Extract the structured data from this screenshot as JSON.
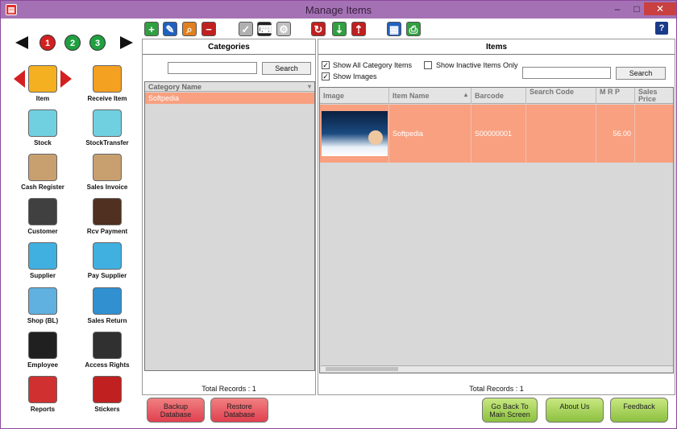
{
  "window": {
    "title": "Manage Items",
    "minimize": "–",
    "maximize": "□",
    "close": "✕"
  },
  "nav": {
    "pages": [
      "1",
      "2",
      "3"
    ],
    "items": [
      {
        "label": "Item",
        "icon": "cart-icon",
        "color": "#f4b020"
      },
      {
        "label": "Receive Item",
        "icon": "truck-icon",
        "color": "#f4a020"
      },
      {
        "label": "Stock",
        "icon": "boxes-icon",
        "color": "#70d0e0"
      },
      {
        "label": "StockTransfer",
        "icon": "transfer-icon",
        "color": "#70d0e0"
      },
      {
        "label": "Cash Register",
        "icon": "register-icon",
        "color": "#c8a070"
      },
      {
        "label": "Sales Invoice",
        "icon": "invoice-icon",
        "color": "#c8a070"
      },
      {
        "label": "Customer",
        "icon": "customers-icon",
        "color": "#404040"
      },
      {
        "label": "Rcv Payment",
        "icon": "payment-icon",
        "color": "#503020"
      },
      {
        "label": "Supplier",
        "icon": "supplier-icon",
        "color": "#40b0e0"
      },
      {
        "label": "Pay Supplier",
        "icon": "pay-supplier-icon",
        "color": "#40b0e0"
      },
      {
        "label": "Shop (BL)",
        "icon": "shop-icon",
        "color": "#60b0e0"
      },
      {
        "label": "Sales Return",
        "icon": "sales-return-icon",
        "color": "#3090d0"
      },
      {
        "label": "Employee",
        "icon": "employee-icon",
        "color": "#202020"
      },
      {
        "label": "Access Rights",
        "icon": "lock-icon",
        "color": "#303030"
      },
      {
        "label": "Reports",
        "icon": "reports-icon",
        "color": "#d03030"
      },
      {
        "label": "Stickers",
        "icon": "barcode-icon",
        "color": "#c02020"
      }
    ]
  },
  "toolbar": {
    "buttons": [
      {
        "name": "add-icon",
        "glyph": "+",
        "color": "#30a040"
      },
      {
        "name": "edit-icon",
        "glyph": "✎",
        "color": "#2060c0"
      },
      {
        "name": "search-icon",
        "glyph": "⌕",
        "color": "#e08020"
      },
      {
        "name": "delete-icon",
        "glyph": "−",
        "color": "#c02020"
      },
      {
        "name": "check-icon",
        "glyph": "✓",
        "color": "#b0b0b0"
      },
      {
        "name": "keyboard-icon",
        "glyph": "⌨",
        "color": "#202020"
      },
      {
        "name": "tools-icon",
        "glyph": "⚙",
        "color": "#c0c0c0"
      },
      {
        "name": "refresh-icon",
        "glyph": "↻",
        "color": "#c02020"
      },
      {
        "name": "import-icon",
        "glyph": "⇣",
        "color": "#30a040"
      },
      {
        "name": "export-icon",
        "glyph": "⇡",
        "color": "#c02020"
      },
      {
        "name": "calendar-icon",
        "glyph": "▦",
        "color": "#2060c0"
      },
      {
        "name": "print-icon",
        "glyph": "⎙",
        "color": "#30a040"
      }
    ],
    "help": "?"
  },
  "categories": {
    "title": "Categories",
    "search_placeholder": "",
    "search_button": "Search",
    "column": "Category Name",
    "rows": [
      "Softpedia"
    ],
    "total": "Total Records : 1"
  },
  "items": {
    "title": "Items",
    "show_all": "Show All Category Items",
    "show_inactive": "Show Inactive Items Only",
    "show_images": "Show Images",
    "show_all_checked": true,
    "show_inactive_checked": false,
    "show_images_checked": true,
    "search_button": "Search",
    "columns": [
      "Image",
      "Item Name",
      "Barcode",
      "Search Code",
      "M R P",
      "Sales Price"
    ],
    "rows": [
      {
        "name": "Softpedia",
        "barcode": "S00000001",
        "search_code": "",
        "mrp": "56.00",
        "sales_price": ""
      }
    ],
    "total": "Total Records : 1"
  },
  "bottom": {
    "backup": "Backup Database",
    "restore": "Restore Database",
    "go_back": "Go Back To Main Screen",
    "about": "About Us",
    "feedback": "Feedback"
  }
}
